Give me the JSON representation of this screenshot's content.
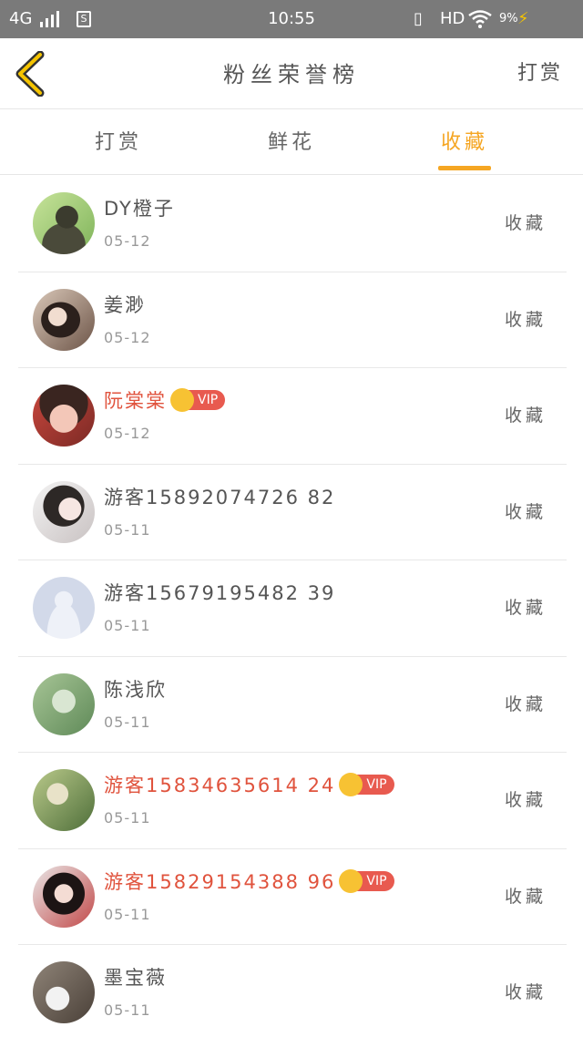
{
  "statusbar": {
    "network": "4G",
    "sim_badge": "S",
    "time": "10:55",
    "vibrate": "▯",
    "hd": "HD",
    "battery": "9%",
    "bolt": "⚡"
  },
  "header": {
    "title": "粉丝荣誉榜",
    "right_label": "打赏"
  },
  "tabs": [
    {
      "label": "打赏"
    },
    {
      "label": "鲜花"
    },
    {
      "label": "收藏"
    }
  ],
  "active_tab": "收藏",
  "colors": {
    "accent": "#f5a623",
    "vip_name": "#e0533d",
    "vip_badge": "#e85a4f"
  },
  "fans": [
    {
      "name": "DY橙子",
      "date": "05-12",
      "action": "收藏"
    },
    {
      "name": "姜渺",
      "date": "05-12",
      "action": "收藏"
    },
    {
      "name": "阮棠棠",
      "date": "05-12",
      "action": "收藏",
      "vip": "VIP"
    },
    {
      "name": "游客15892074726 82",
      "date": "05-11",
      "action": "收藏"
    },
    {
      "name": "游客15679195482 39",
      "date": "05-11",
      "action": "收藏"
    },
    {
      "name": "陈浅欣",
      "date": "05-11",
      "action": "收藏"
    },
    {
      "name": "游客15834635614 24",
      "date": "05-11",
      "action": "收藏",
      "vip": "VIP"
    },
    {
      "name": "游客15829154388 96",
      "date": "05-11",
      "action": "收藏",
      "vip": "VIP"
    },
    {
      "name": "墨宝薇",
      "date": "05-11",
      "action": "收藏"
    }
  ]
}
